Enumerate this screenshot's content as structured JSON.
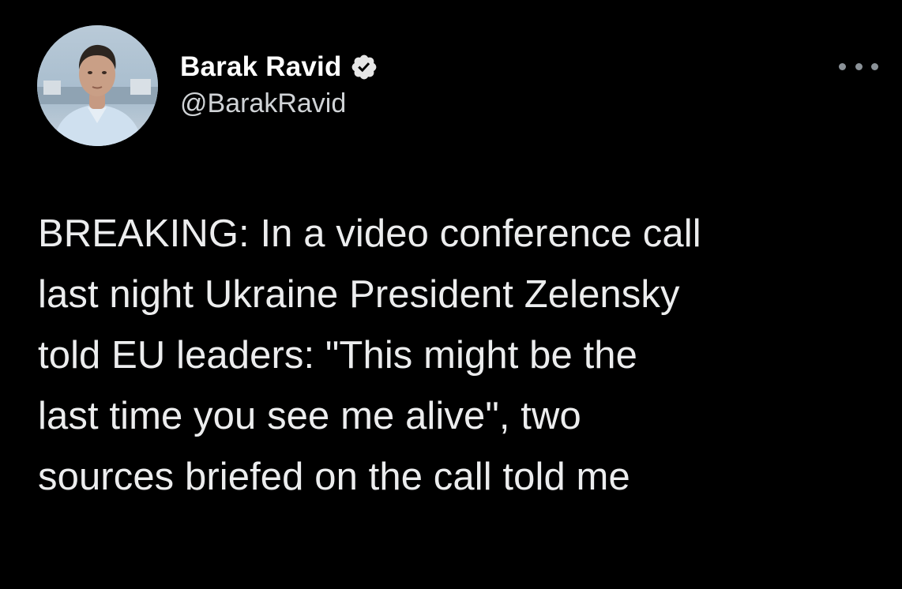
{
  "tweet": {
    "author": {
      "display_name": "Barak Ravid",
      "handle": "@BarakRavid",
      "verified": true,
      "avatar_icon": "profile-photo"
    },
    "more_icon": "more-options-icon",
    "text_lines": [
      "BREAKING: In a video conference call",
      "last night Ukraine President Zelensky",
      "told EU leaders: \"This might be the",
      "last time you see me alive\", two",
      "sources briefed on the call told me"
    ]
  },
  "colors": {
    "background": "#000000",
    "text": "#e7e9ea",
    "secondary_text": "#d0d3d6",
    "verified_badge": "#e6e6e6"
  }
}
